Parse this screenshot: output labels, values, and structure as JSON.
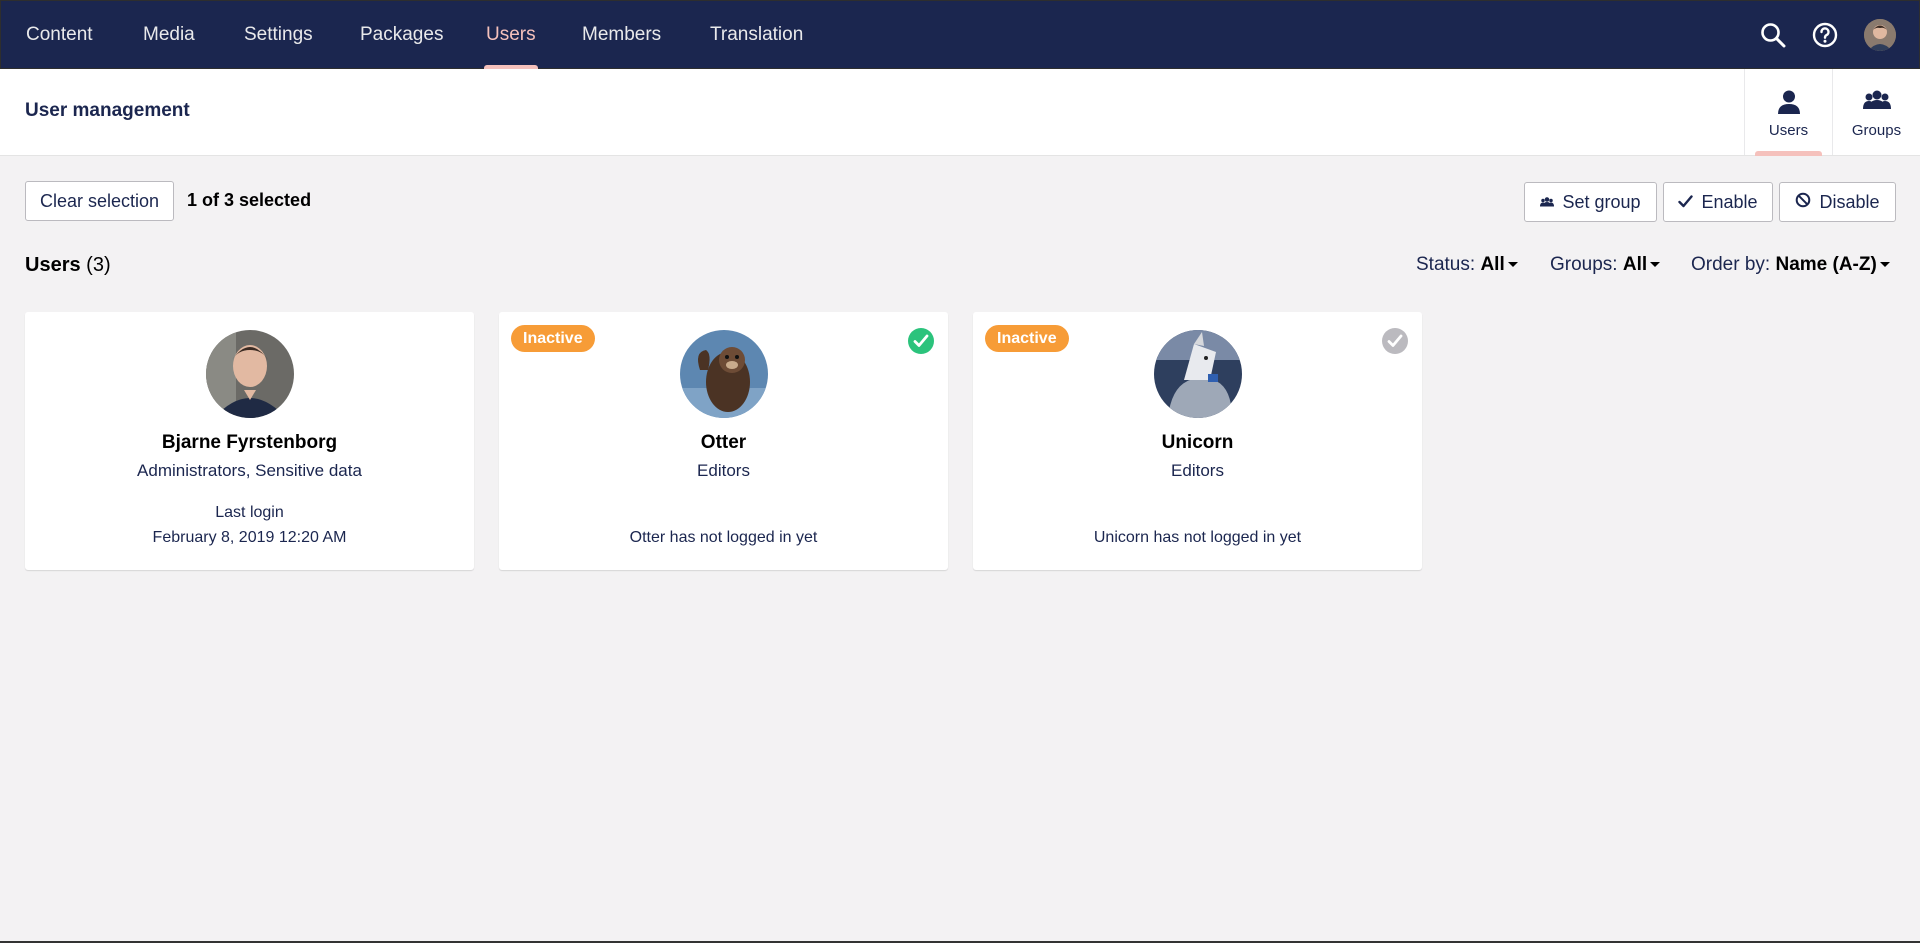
{
  "nav": {
    "items": [
      {
        "label": "Content"
      },
      {
        "label": "Media"
      },
      {
        "label": "Settings"
      },
      {
        "label": "Packages"
      },
      {
        "label": "Users"
      },
      {
        "label": "Members"
      },
      {
        "label": "Translation"
      }
    ],
    "active": "Users",
    "icons": [
      "search-icon",
      "help-icon",
      "user-avatar"
    ]
  },
  "header": {
    "title": "User management",
    "subnav": [
      {
        "label": "Users",
        "icon": "user-icon"
      },
      {
        "label": "Groups",
        "icon": "groups-icon"
      }
    ]
  },
  "toolbar": {
    "clear_label": "Clear selection",
    "selected_text": "1 of 3 selected",
    "set_group_label": "Set group",
    "enable_label": "Enable",
    "disable_label": "Disable"
  },
  "list": {
    "heading": "Users",
    "count": "(3)",
    "filters": {
      "status_label": "Status:",
      "status_value": "All",
      "groups_label": "Groups:",
      "groups_value": "All",
      "order_label": "Order by:",
      "order_value": "Name (A-Z)"
    }
  },
  "users": [
    {
      "name": "Bjarne Fyrstenborg",
      "groups": "Administrators, Sensitive data",
      "login_label": "Last login",
      "login_value": "February 8, 2019 12:20 AM",
      "badge": "",
      "selected": false
    },
    {
      "name": "Otter",
      "groups": "Editors",
      "login_label": "",
      "login_value": "Otter has not logged in yet",
      "badge": "Inactive",
      "selected": true
    },
    {
      "name": "Unicorn",
      "groups": "Editors",
      "login_label": "",
      "login_value": "Unicorn has not logged in yet",
      "badge": "Inactive",
      "selected": false
    }
  ],
  "colors": {
    "nav_bg": "#1b264f",
    "accent": "#f5c1bc",
    "badge": "#f79c37",
    "selected_check": "#2bc37c",
    "unselected_check": "#bbbabf"
  }
}
